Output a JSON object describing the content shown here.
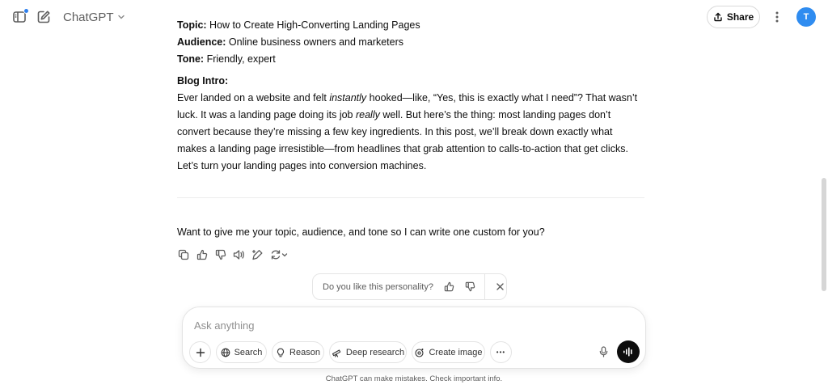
{
  "header": {
    "model_name": "ChatGPT",
    "share_label": "Share",
    "avatar_initial": "T",
    "icons": [
      "sidebar-icon",
      "edit-icon",
      "chevron-down-icon",
      "share-icon",
      "more-vertical-icon"
    ],
    "notification_color": "#2f80ed",
    "avatar_color": "#2f8cf0"
  },
  "message": {
    "topic_label": "Topic:",
    "topic_value": " How to Create High-Converting Landing Pages",
    "audience_label": "Audience:",
    "audience_value": " Online business owners and marketers",
    "tone_label": "Tone:",
    "tone_value": " Friendly, expert",
    "blog_intro_label": "Blog Intro:",
    "intro_p1": "Ever landed on a website and felt ",
    "intro_em1": "instantly",
    "intro_p2": " hooked—like, “Yes, this is exactly what I need”? That wasn’t luck. It was a landing page doing its job ",
    "intro_em2": "really",
    "intro_p3": " well. But here’s the thing: most landing pages don’t convert because they’re missing a few key ingredients. In this post, we’ll break down exactly what makes a landing page irresistible—from headlines that grab attention to calls-to-action that get clicks. Let’s turn your landing pages into conversion machines.",
    "followup": "Want to give me your topic, audience, and tone so I can write one custom for you?"
  },
  "message_actions": [
    "copy-icon",
    "thumbs-up-icon",
    "thumbs-down-icon",
    "read-aloud-icon",
    "edit-in-canvas-icon",
    "regenerate-icon"
  ],
  "personality_prompt": {
    "text": "Do you like this personality?"
  },
  "composer": {
    "placeholder": "Ask anything",
    "value": "",
    "search_label": "Search",
    "reason_label": "Reason",
    "deep_research_label": "Deep research",
    "create_image_label": "Create image",
    "more_label": "•••"
  },
  "footer": {
    "disclaimer": "ChatGPT can make mistakes. Check important info."
  }
}
